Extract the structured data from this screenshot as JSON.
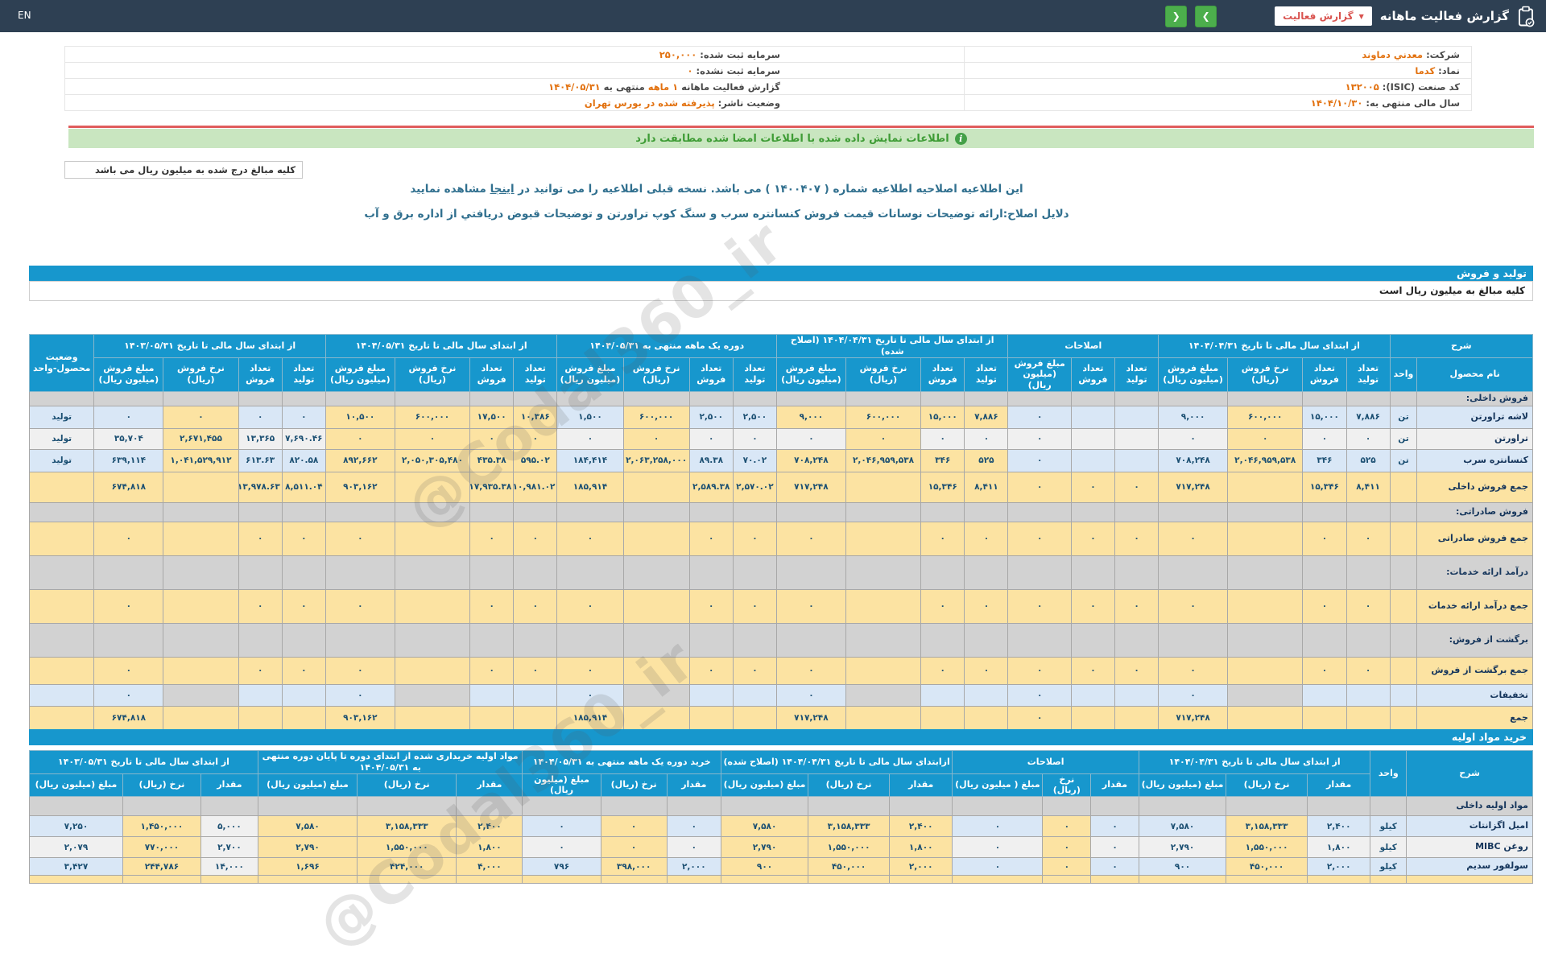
{
  "topbar": {
    "title": "گزارش فعالیت ماهانه",
    "report_type": "گزارش فعالیت",
    "lang": "EN"
  },
  "icons": {
    "caret": "▼",
    "prev": "❮",
    "next": "❯",
    "info": "i"
  },
  "info": {
    "rows": [
      {
        "r": {
          "label": "شرکت:",
          "parts": [
            {
              "t": "معدني دماوند",
              "o": true
            }
          ]
        },
        "l": {
          "label": "سرمایه ثبت شده:",
          "parts": [
            {
              "t": "۲۵۰,۰۰۰",
              "o": true
            }
          ]
        }
      },
      {
        "r": {
          "label": "نماد:",
          "parts": [
            {
              "t": "کدما",
              "o": true
            }
          ]
        },
        "l": {
          "label": "سرمایه ثبت نشده:",
          "parts": [
            {
              "t": "۰",
              "o": true
            }
          ]
        }
      },
      {
        "r": {
          "label": "کد صنعت (ISIC):",
          "parts": [
            {
              "t": "۱۳۲۰۰۵",
              "o": true
            }
          ]
        },
        "l": {
          "label": "گزارش فعالیت ماهانه",
          "parts": [
            {
              "t": "۱ ماهه",
              "o": true
            },
            {
              "t": "منتهی به",
              "o": false
            },
            {
              "t": "۱۴۰۴/۰۵/۳۱",
              "o": true
            }
          ]
        }
      },
      {
        "r": {
          "label": "سال مالی منتهی به:",
          "parts": [
            {
              "t": "۱۴۰۴/۱۰/۳۰",
              "o": true
            }
          ]
        },
        "l": {
          "label": "وضعیت ناشر:",
          "parts": [
            {
              "t": "پذیرفته شده در بورس تهران",
              "o": true
            }
          ]
        }
      }
    ]
  },
  "notice": {
    "text": "اطلاعات نمایش داده شده با اطلاعات امضا شده مطابقت دارد"
  },
  "notes": {
    "million_note": "کلیه مبالغ درج شده به میلیون ریال می باشد"
  },
  "amendment": {
    "line1_pre": "این اطلاعیه اصلاحیه اطلاعیه شماره ( ۱۴۰۰۴۰۷ ) می باشد. نسخه قبلی اطلاعیه را می توانید در ",
    "link_text": "اینجا",
    "line1_post": " مشاهده نمایید",
    "line2": "دلایل اصلاح:ارائه توضیحات نوسانات قیمت فروش کنسانتره سرب و سنگ کوپ تراورتن و توضیحات قبوض دریافتي از اداره برق و آب"
  },
  "watermark": "@Codal360_ir",
  "colors": {
    "accent": "#1797CD",
    "highlight": "#FCE3A2",
    "stripe_blue": "#D9E7F6",
    "stripe_gray": "#F0F0F0",
    "section_gray": "#D2D2D2",
    "orange": "#E2710F",
    "green_bar": "#C9E6C0",
    "red_line": "#E05D5D",
    "topbar": "#2E4053",
    "button_green": "#4CAE4C",
    "button_red_text": "#D9534F"
  },
  "production": {
    "title": "تولید و فروش",
    "subtitle": "کلیه مبالغ به میلیون ریال است",
    "status_col": true,
    "groups": [
      {
        "label": "شرح",
        "cols": [
          "نام محصول",
          "واحد"
        ]
      },
      {
        "label": "از ابتدای سال مالی تا تاریخ ۱۴۰۴/۰۴/۳۱",
        "cols": [
          "تعداد تولید",
          "تعداد فروش",
          "نرخ فروش (ریال)",
          "مبلغ فروش (میلیون ریال)"
        ]
      },
      {
        "label": "اصلاحات",
        "cols": [
          "تعداد تولید",
          "تعداد فروش",
          "مبلغ فروش (میلیون ریال)"
        ]
      },
      {
        "label": "از ابتدای سال مالی تا تاریخ ۱۴۰۴/۰۴/۳۱ (اصلاح شده)",
        "cols": [
          "تعداد تولید",
          "تعداد فروش",
          "نرخ فروش (ریال)",
          "مبلغ فروش (میلیون ریال)"
        ]
      },
      {
        "label": "دوره یک ماهه منتهی به ۱۴۰۴/۰۵/۳۱",
        "cols": [
          "تعداد تولید",
          "تعداد فروش",
          "نرخ فروش (ریال)",
          "مبلغ فروش (میلیون ریال)"
        ]
      },
      {
        "label": "از ابتدای سال مالی تا تاریخ ۱۴۰۴/۰۵/۳۱",
        "cols": [
          "تعداد تولید",
          "تعداد فروش",
          "نرخ فروش (ریال)",
          "مبلغ فروش (میلیون ریال)"
        ]
      },
      {
        "label": "از ابتدای سال مالی تا تاریخ ۱۴۰۳/۰۵/۳۱",
        "cols": [
          "تعداد تولید",
          "تعداد فروش",
          "نرخ فروش (ریال)",
          "مبلغ فروش (میلیون ریال)"
        ]
      },
      {
        "label": "وضعیت محصول-واحد",
        "cols": []
      }
    ],
    "rows": [
      {
        "type": "section",
        "label": "فروش داخلی:"
      },
      {
        "type": "data",
        "label": "لاشه تراورتن",
        "unit": "تن",
        "status": "تولید",
        "s": "b",
        "cells": [
          [
            "۷,۸۸۶",
            "b"
          ],
          [
            "۱۵,۰۰۰",
            "b"
          ],
          [
            "۶۰۰,۰۰۰",
            "y"
          ],
          [
            "۹,۰۰۰",
            "b"
          ],
          [
            "",
            "b"
          ],
          [
            "",
            "b"
          ],
          [
            "۰",
            "b"
          ],
          [
            "۷,۸۸۶",
            "y"
          ],
          [
            "۱۵,۰۰۰",
            "y"
          ],
          [
            "۶۰۰,۰۰۰",
            "y"
          ],
          [
            "۹,۰۰۰",
            "y"
          ],
          [
            "۲,۵۰۰",
            "b"
          ],
          [
            "۲,۵۰۰",
            "b"
          ],
          [
            "۶۰۰,۰۰۰",
            "y"
          ],
          [
            "۱,۵۰۰",
            "b"
          ],
          [
            "۱۰,۳۸۶",
            "y"
          ],
          [
            "۱۷,۵۰۰",
            "y"
          ],
          [
            "۶۰۰,۰۰۰",
            "y"
          ],
          [
            "۱۰,۵۰۰",
            "y"
          ],
          [
            "۰",
            "b"
          ],
          [
            "۰",
            "b"
          ],
          [
            "۰",
            "y"
          ],
          [
            "۰",
            "b"
          ]
        ]
      },
      {
        "type": "data",
        "label": "تراورتن",
        "unit": "تن",
        "status": "تولید",
        "s": "w",
        "cells": [
          [
            "۰",
            "w"
          ],
          [
            "۰",
            "w"
          ],
          [
            "۰",
            "y"
          ],
          [
            "۰",
            "w"
          ],
          [
            "",
            "w"
          ],
          [
            "",
            "w"
          ],
          [
            "۰",
            "w"
          ],
          [
            "۰",
            "w"
          ],
          [
            "۰",
            "w"
          ],
          [
            "۰",
            "y"
          ],
          [
            "۰",
            "w"
          ],
          [
            "۰",
            "w"
          ],
          [
            "۰",
            "w"
          ],
          [
            "۰",
            "y"
          ],
          [
            "۰",
            "w"
          ],
          [
            "۰",
            "y"
          ],
          [
            "۰",
            "y"
          ],
          [
            "۰",
            "y"
          ],
          [
            "۰",
            "y"
          ],
          [
            "۷,۶۹۰.۴۶",
            "w"
          ],
          [
            "۱۳,۳۶۵",
            "w"
          ],
          [
            "۲,۶۷۱,۴۵۵",
            "y"
          ],
          [
            "۳۵,۷۰۴",
            "w"
          ]
        ]
      },
      {
        "type": "data",
        "label": "کنسانتره سرب",
        "unit": "تن",
        "status": "تولید",
        "s": "b",
        "cells": [
          [
            "۵۲۵",
            "b"
          ],
          [
            "۳۴۶",
            "b"
          ],
          [
            "۲,۰۴۶,۹۵۹,۵۳۸",
            "y"
          ],
          [
            "۷۰۸,۲۴۸",
            "b"
          ],
          [
            "",
            "b"
          ],
          [
            "",
            "b"
          ],
          [
            "۰",
            "b"
          ],
          [
            "۵۲۵",
            "y"
          ],
          [
            "۳۴۶",
            "y"
          ],
          [
            "۲,۰۴۶,۹۵۹,۵۳۸",
            "y"
          ],
          [
            "۷۰۸,۲۴۸",
            "y"
          ],
          [
            "۷۰.۰۲",
            "b"
          ],
          [
            "۸۹.۳۸",
            "b"
          ],
          [
            "۲,۰۶۳,۲۵۸,۰۰۰",
            "y"
          ],
          [
            "۱۸۴,۴۱۴",
            "b"
          ],
          [
            "۵۹۵.۰۲",
            "y"
          ],
          [
            "۴۳۵.۳۸",
            "y"
          ],
          [
            "۲,۰۵۰,۳۰۵,۴۸۰",
            "y"
          ],
          [
            "۸۹۲,۶۶۲",
            "y"
          ],
          [
            "۸۲۰.۵۸",
            "b"
          ],
          [
            "۶۱۳.۶۳",
            "b"
          ],
          [
            "۱,۰۴۱,۵۲۹,۹۱۲",
            "y"
          ],
          [
            "۶۳۹,۱۱۴",
            "b"
          ]
        ]
      },
      {
        "type": "sum",
        "label": "جمع فروش داخلی",
        "cells": [
          "۸,۴۱۱",
          "۱۵,۳۴۶",
          "",
          "۷۱۷,۲۴۸",
          "۰",
          "۰",
          "۰",
          "۸,۴۱۱",
          "۱۵,۳۴۶",
          "",
          "۷۱۷,۲۴۸",
          "۲,۵۷۰.۰۲",
          "۲,۵۸۹.۳۸",
          "",
          "۱۸۵,۹۱۴",
          "۱۰,۹۸۱.۰۲",
          "۱۷,۹۳۵.۳۸",
          "",
          "۹۰۳,۱۶۲",
          "۸,۵۱۱.۰۴",
          "۱۳,۹۷۸.۶۳",
          "",
          "۶۷۴,۸۱۸"
        ]
      },
      {
        "type": "section",
        "label": "فروش صادراتی:"
      },
      {
        "type": "sum",
        "label": "جمع فروش صادراتی",
        "cells": [
          "۰",
          "۰",
          "",
          "۰",
          "۰",
          "۰",
          "۰",
          "۰",
          "۰",
          "",
          "۰",
          "۰",
          "۰",
          "",
          "۰",
          "۰",
          "۰",
          "",
          "۰",
          "۰",
          "۰",
          "",
          "۰"
        ]
      },
      {
        "type": "section",
        "label": "درآمد ارائه خدمات:"
      },
      {
        "type": "sum",
        "label": "جمع درآمد ارائه خدمات",
        "cells": [
          "۰",
          "۰",
          "",
          "۰",
          "۰",
          "۰",
          "۰",
          "۰",
          "۰",
          "",
          "۰",
          "۰",
          "۰",
          "",
          "۰",
          "۰",
          "۰",
          "",
          "۰",
          "۰",
          "۰",
          "",
          "۰"
        ]
      },
      {
        "type": "section",
        "label": "برگشت از فروش:"
      },
      {
        "type": "sum",
        "label": "جمع برگشت از فروش",
        "cells": [
          "۰",
          "۰",
          "",
          "۰",
          "۰",
          "۰",
          "۰",
          "۰",
          "۰",
          "",
          "۰",
          "۰",
          "۰",
          "",
          "۰",
          "۰",
          "۰",
          "",
          "۰",
          "۰",
          "۰",
          "",
          "۰"
        ]
      },
      {
        "type": "data",
        "label": "تخفیفات",
        "unit": "",
        "status": "",
        "s": "b",
        "cells": [
          [
            "",
            "b"
          ],
          [
            "",
            "b"
          ],
          [
            "",
            "g"
          ],
          [
            "۰",
            "b"
          ],
          [
            "",
            "b"
          ],
          [
            "",
            "b"
          ],
          [
            "۰",
            "b"
          ],
          [
            "",
            "b"
          ],
          [
            "",
            "b"
          ],
          [
            "",
            "g"
          ],
          [
            "۰",
            "b"
          ],
          [
            "",
            "b"
          ],
          [
            "",
            "b"
          ],
          [
            "",
            "g"
          ],
          [
            "۰",
            "b"
          ],
          [
            "",
            "b"
          ],
          [
            "",
            "b"
          ],
          [
            "",
            "g"
          ],
          [
            "۰",
            "b"
          ],
          [
            "",
            "b"
          ],
          [
            "",
            "b"
          ],
          [
            "",
            "g"
          ],
          [
            "۰",
            "b"
          ]
        ]
      },
      {
        "type": "sum",
        "label": "جمع",
        "cells": [
          "",
          "",
          "",
          "۷۱۷,۲۴۸",
          "",
          "",
          "۰",
          "",
          "",
          "",
          "۷۱۷,۲۴۸",
          "",
          "",
          "",
          "۱۸۵,۹۱۴",
          "",
          "",
          "",
          "۹۰۳,۱۶۲",
          "",
          "",
          "",
          "۶۷۴,۸۱۸"
        ]
      }
    ]
  },
  "materials": {
    "title": "خرید مواد اولیه",
    "status_col": false,
    "groups": [
      {
        "label": "شرح",
        "cols": []
      },
      {
        "label": "واحد",
        "cols": []
      },
      {
        "label": "از ابتدای سال مالی تا تاریخ ۱۴۰۴/۰۴/۳۱",
        "cols": [
          "مقدار",
          "نرخ (ریال)",
          "مبلغ (میلیون ریال)"
        ]
      },
      {
        "label": "اصلاحات",
        "cols": [
          "مقدار",
          "نرخ (ریال)",
          "مبلغ ( میلیون ریال)"
        ]
      },
      {
        "label": "ازابتدای سال مالی تا تاریخ ۱۴۰۴/۰۴/۳۱ (اصلاح شده)",
        "cols": [
          "مقدار",
          "نرخ (ریال)",
          "مبلغ (میلیون ریال)"
        ]
      },
      {
        "label": "خرید دوره یک ماهه منتهی به ۱۴۰۴/۰۵/۳۱",
        "cols": [
          "مقدار",
          "نرخ (ریال)",
          "مبلغ (میلیون ریال)"
        ]
      },
      {
        "label": "مواد اولیه خریداری شده از ابتدای دوره تا پایان دوره منتهی به ۱۴۰۴/۰۵/۳۱",
        "cols": [
          "مقدار",
          "نرخ (ریال)",
          "مبلغ (میلیون ریال)"
        ]
      },
      {
        "label": "از ابتدای سال مالی تا تاریخ ۱۴۰۳/۰۵/۳۱",
        "cols": [
          "مقدار",
          "نرخ (ریال)",
          "مبلغ (میلیون ریال)"
        ]
      }
    ],
    "rows": [
      {
        "type": "section",
        "label": "مواد اولیه داخلی"
      },
      {
        "type": "data",
        "label": "امیل اگزانتات",
        "unit": "کیلو",
        "s": "b",
        "cells": [
          [
            "۲,۴۰۰",
            "b"
          ],
          [
            "۳,۱۵۸,۳۳۳",
            "y"
          ],
          [
            "۷,۵۸۰",
            "b"
          ],
          [
            "۰",
            "b"
          ],
          [
            "۰",
            "y"
          ],
          [
            "۰",
            "b"
          ],
          [
            "۲,۴۰۰",
            "y"
          ],
          [
            "۳,۱۵۸,۳۳۳",
            "y"
          ],
          [
            "۷,۵۸۰",
            "y"
          ],
          [
            "۰",
            "b"
          ],
          [
            "۰",
            "y"
          ],
          [
            "۰",
            "b"
          ],
          [
            "۲,۴۰۰",
            "y"
          ],
          [
            "۳,۱۵۸,۳۳۳",
            "y"
          ],
          [
            "۷,۵۸۰",
            "y"
          ],
          [
            "۵,۰۰۰",
            "w"
          ],
          [
            "۱,۴۵۰,۰۰۰",
            "y"
          ],
          [
            "۷,۲۵۰",
            "b"
          ]
        ]
      },
      {
        "type": "data",
        "label": "روغن MIBC",
        "unit": "کیلو",
        "s": "w",
        "cells": [
          [
            "۱,۸۰۰",
            "w"
          ],
          [
            "۱,۵۵۰,۰۰۰",
            "y"
          ],
          [
            "۲,۷۹۰",
            "w"
          ],
          [
            "۰",
            "w"
          ],
          [
            "۰",
            "y"
          ],
          [
            "۰",
            "w"
          ],
          [
            "۱,۸۰۰",
            "y"
          ],
          [
            "۱,۵۵۰,۰۰۰",
            "y"
          ],
          [
            "۲,۷۹۰",
            "y"
          ],
          [
            "۰",
            "w"
          ],
          [
            "۰",
            "y"
          ],
          [
            "۰",
            "w"
          ],
          [
            "۱,۸۰۰",
            "y"
          ],
          [
            "۱,۵۵۰,۰۰۰",
            "y"
          ],
          [
            "۲,۷۹۰",
            "y"
          ],
          [
            "۲,۷۰۰",
            "w"
          ],
          [
            "۷۷۰,۰۰۰",
            "y"
          ],
          [
            "۲,۰۷۹",
            "w"
          ]
        ]
      },
      {
        "type": "data",
        "label": "سولفور سدیم",
        "unit": "کیلو",
        "s": "b",
        "cells": [
          [
            "۲,۰۰۰",
            "b"
          ],
          [
            "۴۵۰,۰۰۰",
            "y"
          ],
          [
            "۹۰۰",
            "b"
          ],
          [
            "۰",
            "b"
          ],
          [
            "۰",
            "y"
          ],
          [
            "۰",
            "b"
          ],
          [
            "۲,۰۰۰",
            "y"
          ],
          [
            "۴۵۰,۰۰۰",
            "y"
          ],
          [
            "۹۰۰",
            "y"
          ],
          [
            "۲,۰۰۰",
            "b"
          ],
          [
            "۳۹۸,۰۰۰",
            "y"
          ],
          [
            "۷۹۶",
            "b"
          ],
          [
            "۴,۰۰۰",
            "y"
          ],
          [
            "۴۲۴,۰۰۰",
            "y"
          ],
          [
            "۱,۶۹۶",
            "y"
          ],
          [
            "۱۴,۰۰۰",
            "w"
          ],
          [
            "۲۴۴,۷۸۶",
            "y"
          ],
          [
            "۳,۴۲۷",
            "b"
          ]
        ]
      },
      {
        "type": "sum",
        "label": "",
        "cells": [
          "",
          "",
          "",
          "",
          "",
          "",
          "",
          "",
          "",
          "",
          "",
          "",
          "",
          "",
          "",
          "",
          "",
          ""
        ]
      }
    ]
  }
}
